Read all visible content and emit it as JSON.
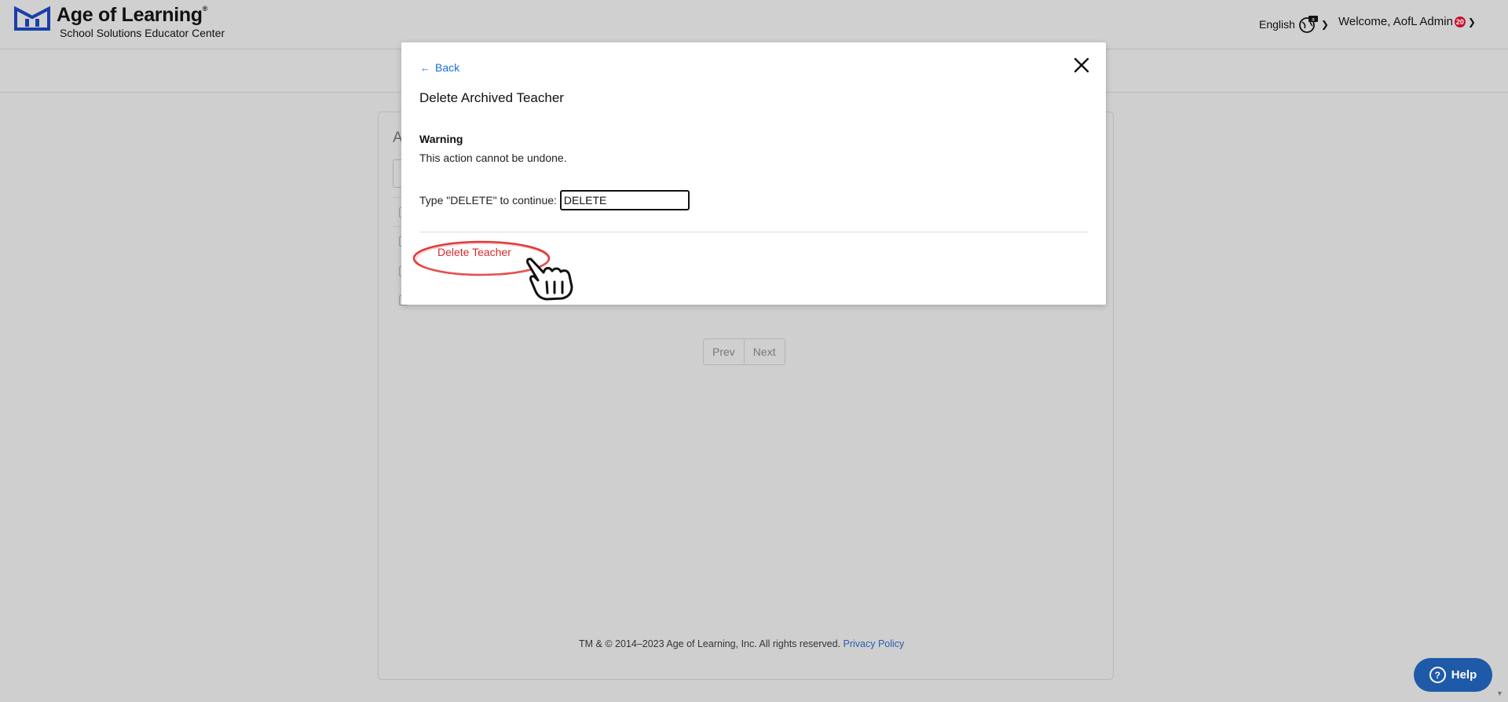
{
  "header": {
    "brand": "Age of Learning",
    "brand_mark": "®",
    "subtitle": "School Solutions Educator Center",
    "language": "English",
    "welcome": "Welcome, AofL Admin",
    "notification_count": "20"
  },
  "card": {
    "title_partial": "A",
    "pagination": {
      "prev": "Prev",
      "next": "Next"
    },
    "footer": {
      "copyright": "TM & © 2014–2023 Age of Learning, Inc. All rights reserved.",
      "privacy": "Privacy Policy"
    }
  },
  "modal": {
    "back": "Back",
    "title": "Delete Archived Teacher",
    "warning_heading": "Warning",
    "warning_text": "This action cannot be undone.",
    "confirm_label": "Type \"DELETE\" to continue:",
    "confirm_value": "DELETE",
    "delete_button": "Delete Teacher"
  },
  "help": {
    "label": "Help"
  },
  "colors": {
    "accent": "#1a6ed8",
    "danger": "#d12b2b",
    "help_button": "#1e5aa8",
    "badge": "#c8102e",
    "overlay": "#cfcfcf"
  },
  "icons": [
    "logo-icon",
    "globe-icon",
    "chevron-down-icon",
    "back-arrow-icon",
    "close-icon",
    "hand-cursor-icon",
    "question-icon"
  ]
}
